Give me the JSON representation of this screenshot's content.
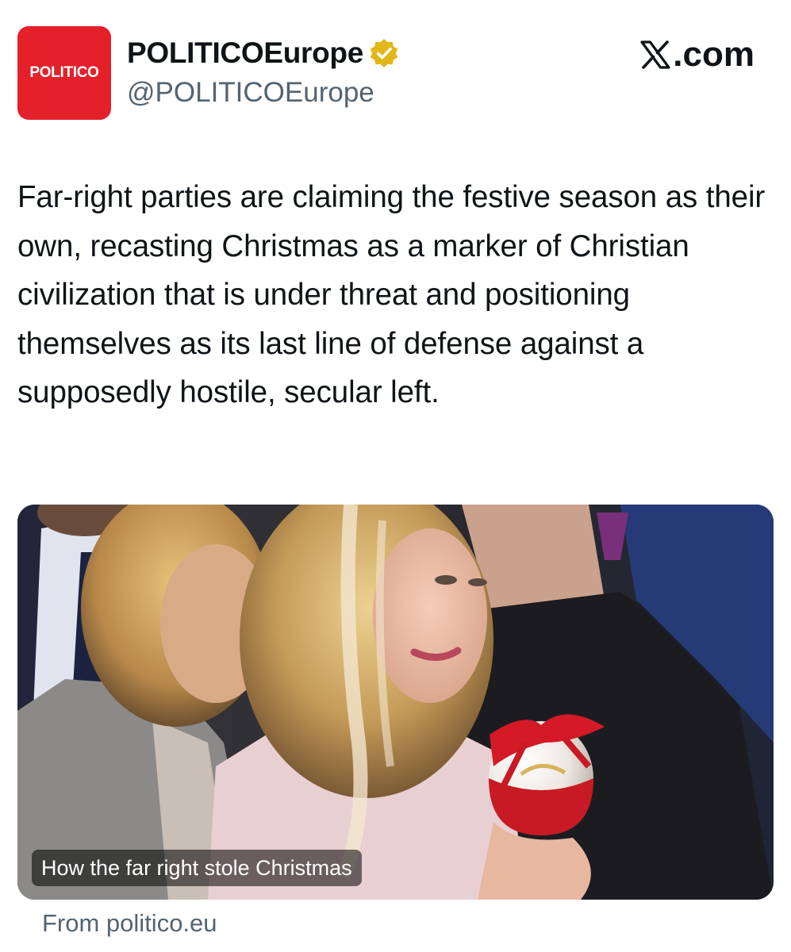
{
  "account": {
    "avatar_text": "POLITICO",
    "display_name": "POLITICOEurope",
    "handle": "@POLITICOEurope",
    "verified_icon": "verified-badge-icon",
    "brand_color": "#e4202a"
  },
  "brand": {
    "label": ".com",
    "icon": "x-logo-icon"
  },
  "tweet": {
    "text": "Far-right parties are claiming the festive season as their own, recasting Christmas as a marker of Christian civilization that is under threat and positioning themselves as its last line of defense against a supposedly hostile, secular left."
  },
  "link_card": {
    "caption": "How the far right stole Christmas",
    "source": "From politico.eu"
  },
  "colors": {
    "text": "#0f1419",
    "secondary": "#536471",
    "verified_gold": "#e2b719"
  }
}
